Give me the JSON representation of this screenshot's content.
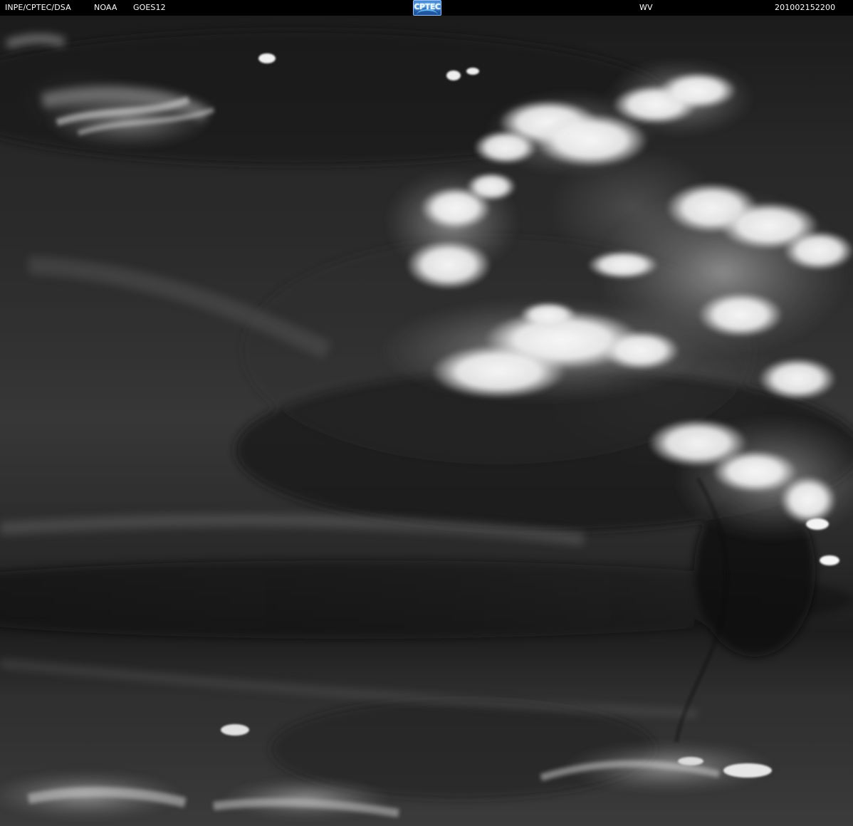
{
  "header": {
    "org": "INPE/CPTEC/DSA",
    "agency": "NOAA",
    "satellite": "GOES12",
    "channel": "WV",
    "timestamp": "201002152200"
  },
  "logo": {
    "text": "CPTEC"
  },
  "image": {
    "type": "satellite-water-vapor-image",
    "description_visible": ""
  },
  "colors": {
    "background": "#000000",
    "header_text": "#ffffff",
    "logo_blue": "#2a64b5",
    "cloud_white": "#ffffff",
    "dark_sky": "#1d1d1d"
  },
  "icons": {
    "logo": "cptec-logo-icon"
  }
}
